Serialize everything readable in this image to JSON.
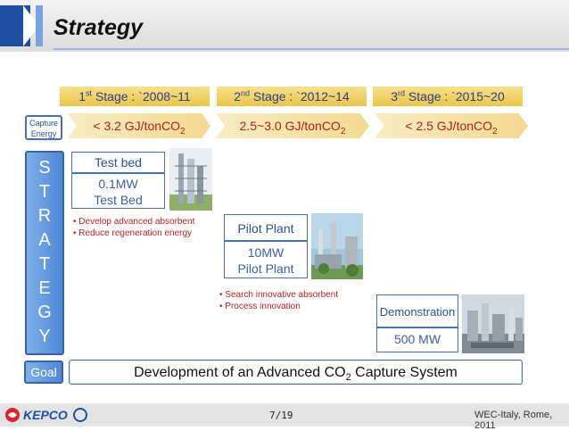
{
  "title": "Strategy",
  "stages": [
    {
      "ordinal": "1",
      "suffix": "st",
      "label": " Stage : `2008~11",
      "capture_main": "< 3.2 GJ/tonCO",
      "capture_sub": "2"
    },
    {
      "ordinal": "2",
      "suffix": "nd",
      "label": " Stage : `2012~14",
      "capture_main": "2.5~3.0 GJ/tonCO",
      "capture_sub": "2"
    },
    {
      "ordinal": "3",
      "suffix": "rd",
      "label": " Stage : `2015~20",
      "capture_main": "< 2.5 GJ/tonCO",
      "capture_sub": "2"
    }
  ],
  "capture_label": [
    "Capture",
    "Energy"
  ],
  "strategy_letters": [
    "S",
    "T",
    "R",
    "A",
    "T",
    "E",
    "G",
    "Y"
  ],
  "goal_label": "Goal",
  "goal_text": {
    "before": "Development of an Advanced CO",
    "sub": "2",
    "after": " Capture System"
  },
  "stage1": {
    "title": "Test bed",
    "body": [
      "0.1MW",
      "Test Bed"
    ],
    "bullets": [
      "• Develop advanced absorbent",
      "• Reduce regeneration energy"
    ]
  },
  "stage2": {
    "title": "Pilot Plant",
    "body": [
      "10MW",
      "Pilot Plant"
    ],
    "bullets": [
      "• Search innovative absorbent",
      "• Process innovation"
    ]
  },
  "stage3": {
    "title": "Demonstration",
    "body": [
      "500 MW"
    ]
  },
  "footer": {
    "page": "7/19",
    "right": "WEC-Italy, Rome, 2011",
    "logo_text": "KEPCO"
  },
  "colors": {
    "stage_bar": "#e9c54b",
    "stage_text": "#2d3e8a",
    "capture_text": "#b02020",
    "bullet_text": "#c02020",
    "box_border": "#4a6fb0",
    "strategy_fill": "#4f86d6"
  }
}
